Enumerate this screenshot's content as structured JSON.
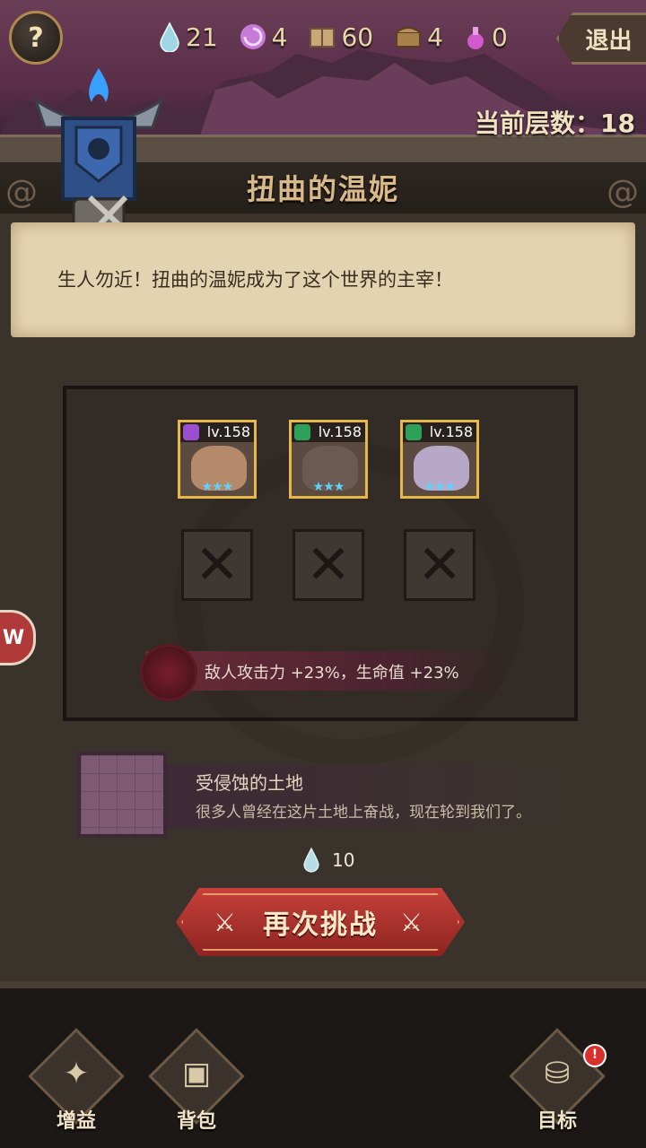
{
  "header": {
    "help_label": "?",
    "exit_label": "退出",
    "floor_label": "当前层数：",
    "floor_value": "18"
  },
  "resources": [
    {
      "name": "water-drop-icon",
      "value": "21",
      "color": "#9fd6e6"
    },
    {
      "name": "purple-swirl-icon",
      "value": "4",
      "color": "#c77ad8"
    },
    {
      "name": "supply-box-icon",
      "value": "60",
      "color": "#c8a878"
    },
    {
      "name": "treasure-chest-icon",
      "value": "4",
      "color": "#a8804a"
    },
    {
      "name": "potion-icon",
      "value": "0",
      "color": "#d05acc"
    }
  ],
  "boss": {
    "title": "扭曲的温妮",
    "description": "生人勿近！扭曲的温妮成为了这个世界的主宰！"
  },
  "enemies": [
    {
      "level": "lv.158",
      "stars": "★★★",
      "element_color": "#9b4fd0",
      "face_color": "#b48a6a"
    },
    {
      "level": "lv.158",
      "stars": "★★★",
      "element_color": "#2ea05a",
      "face_color": "#6b5a52"
    },
    {
      "level": "lv.158",
      "stars": "★★★",
      "element_color": "#2ea05a",
      "face_color": "#b8a8c8"
    }
  ],
  "empty_slot_symbol": "✕",
  "buff_text": "敌人攻击力 +23%，生命值 +23%",
  "terrain": {
    "name": "受侵蚀的土地",
    "description": "很多人曾经在这片土地上奋战，现在轮到我们了。"
  },
  "cost": {
    "value": "10"
  },
  "challenge_label": "再次挑战",
  "nav": [
    {
      "label": "增益",
      "icon": "boost-icon",
      "badge": ""
    },
    {
      "label": "背包",
      "icon": "backpack-icon",
      "badge": ""
    },
    {
      "label": "目标",
      "icon": "goal-chest-icon",
      "badge": "!"
    }
  ],
  "colors": {
    "accent_gold": "#e6b84a",
    "challenge_red": "#c6413a"
  }
}
